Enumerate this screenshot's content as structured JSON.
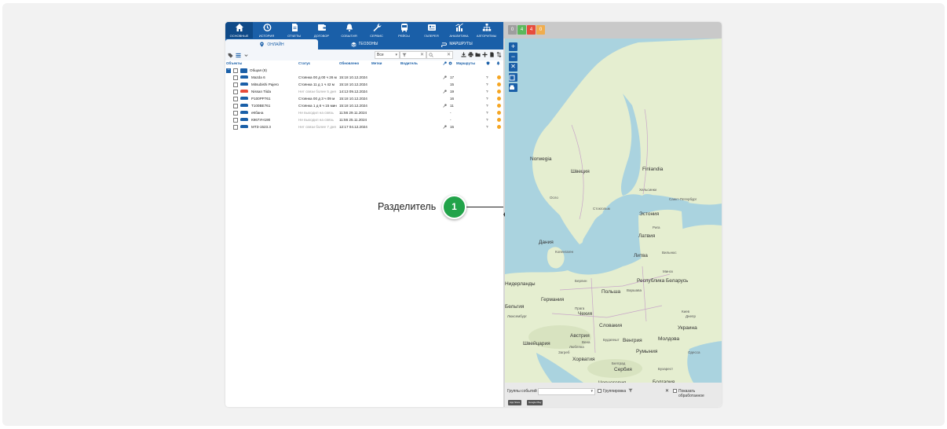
{
  "nav": {
    "items": [
      {
        "label": "Основные",
        "icon": "home-icon",
        "active": true
      },
      {
        "label": "История",
        "icon": "history-icon"
      },
      {
        "label": "Отчеты",
        "icon": "report-icon"
      },
      {
        "label": "Договор",
        "icon": "wallet-icon"
      },
      {
        "label": "События",
        "icon": "bell-icon"
      },
      {
        "label": "Сервис",
        "icon": "wrench-icon"
      },
      {
        "label": "Рейсы",
        "icon": "bus-icon"
      },
      {
        "label": "Галерея",
        "icon": "gallery-icon"
      },
      {
        "label": "Аналитика",
        "icon": "analytics-icon"
      },
      {
        "label": "Алгоритмы",
        "icon": "algorithm-icon"
      }
    ]
  },
  "badges": [
    {
      "value": "0",
      "color": "#9e9e9e"
    },
    {
      "value": "4",
      "color": "#5cb85c"
    },
    {
      "value": "4",
      "color": "#e74c3c"
    },
    {
      "value": "0",
      "color": "#f0ad4e"
    }
  ],
  "tabs": [
    {
      "label": "Онлайн",
      "icon": "pin-icon",
      "active": true
    },
    {
      "label": "Геозоны",
      "icon": "layers-icon"
    },
    {
      "label": "Маршруты",
      "icon": "route-icon"
    }
  ],
  "toolbar": {
    "select_value": "Все",
    "filter_clear": "✕",
    "search_clear": "✕"
  },
  "columns": {
    "objects": "Объекты",
    "status": "Статус",
    "updated": "Обновлено",
    "tags": "Метки",
    "driver": "Водитель",
    "routes": "Маршруты"
  },
  "group": {
    "name": "Общая (8)"
  },
  "objects": [
    {
      "name": "Mazda 6",
      "status": "Стоянка 00 д 00 ч 26 м",
      "time": "15:18 10.12.2024",
      "key": true,
      "routes": "17",
      "q": "?",
      "car_color": "#1a5fa8"
    },
    {
      "name": "Mitsubishi Pajero",
      "status": "Стоянка 11 д 1 ч 42 м",
      "time": "15:18 10.12.2024",
      "key": false,
      "routes": "15",
      "q": "?",
      "car_color": "#1a5fa8"
    },
    {
      "name": "Nissan Tiida",
      "status": "Нет связи более 5 дня",
      "time": "14:13 09.12.2024",
      "key": true,
      "routes": "19",
      "q": "?",
      "car_color": "#e74c3c",
      "status_gray": true
    },
    {
      "name": "Р100РР761",
      "status": "Стоянка 00 д 3 ч 09 м",
      "time": "15:18 10.12.2024",
      "key": false,
      "routes": "16",
      "q": "?",
      "car_color": "#1a5fa8"
    },
    {
      "name": "Т100ВЕ761",
      "status": "Стоянка 1 д 6 ч 15 мин",
      "time": "15:18 10.12.2024",
      "key": true,
      "routes": "11",
      "q": "?",
      "car_color": "#1a5fa8"
    },
    {
      "name": "еКбана",
      "status": "Не выходил на связь",
      "time": "11:56 29.11.2024",
      "key": false,
      "routes": "-",
      "q": "?",
      "car_color": "#1a5fa8",
      "status_gray": true
    },
    {
      "name": "К967УН190",
      "status": "Не выходил на связь",
      "time": "11:56 25.11.2024",
      "key": false,
      "routes": "-",
      "q": "?",
      "car_color": "#1a5fa8",
      "status_gray": true
    },
    {
      "name": "МТЗ-1523.3",
      "status": "Нет связи более 7 дня",
      "time": "12:17 04.12.2024",
      "key": true,
      "routes": "15",
      "q": "?",
      "car_color": "#1a5fa8",
      "status_gray": true
    }
  ],
  "map": {
    "labels": [
      {
        "text": "Norwegia",
        "small": false
      },
      {
        "text": "Швеция",
        "small": false
      },
      {
        "text": "Finlandia",
        "small": false
      },
      {
        "text": "Хельсинки",
        "small": true
      },
      {
        "text": "Санкт-Петербург",
        "small": true
      },
      {
        "text": "Осло",
        "small": true
      },
      {
        "text": "Стокгольм",
        "small": true
      },
      {
        "text": "Эстония",
        "small": false
      },
      {
        "text": "Рига",
        "small": true
      },
      {
        "text": "Латвия",
        "small": false
      },
      {
        "text": "Дания",
        "small": false
      },
      {
        "text": "Копенгаген",
        "small": true
      },
      {
        "text": "Литва",
        "small": false
      },
      {
        "text": "Вильнюс",
        "small": true
      },
      {
        "text": "Минск",
        "small": true
      },
      {
        "text": "Республика Беларусь",
        "small": false
      },
      {
        "text": "Нидерланды",
        "small": false
      },
      {
        "text": "Берлин",
        "small": true
      },
      {
        "text": "Варшава",
        "small": true
      },
      {
        "text": "Польша",
        "small": false
      },
      {
        "text": "Германия",
        "small": false
      },
      {
        "text": "Бельгия",
        "small": false
      },
      {
        "text": "Люксембург",
        "small": true
      },
      {
        "text": "Прага",
        "small": true
      },
      {
        "text": "Чехия",
        "small": false
      },
      {
        "text": "Киев",
        "small": true
      },
      {
        "text": "Украина",
        "small": false
      },
      {
        "text": "Словакия",
        "small": false
      },
      {
        "text": "Вена",
        "small": true
      },
      {
        "text": "Австрия",
        "small": false
      },
      {
        "text": "Будапешт",
        "small": true
      },
      {
        "text": "Венгрия",
        "small": false
      },
      {
        "text": "Молдова",
        "small": false
      },
      {
        "text": "Швейцария",
        "small": false
      },
      {
        "text": "Любляна",
        "small": true
      },
      {
        "text": "Хорватия",
        "small": false
      },
      {
        "text": "Румыния",
        "small": false
      },
      {
        "text": "Бухарест",
        "small": true
      },
      {
        "text": "Сербия",
        "small": false
      },
      {
        "text": "Болгария",
        "small": false
      },
      {
        "text": "Черногория",
        "small": false
      },
      {
        "text": "Днепр",
        "small": true
      },
      {
        "text": "Одесса",
        "small": true
      },
      {
        "text": "Белград",
        "small": true
      },
      {
        "text": "Загреб",
        "small": true
      }
    ],
    "controls": [
      "+",
      "−",
      "✕",
      "",
      ""
    ]
  },
  "events": {
    "label": "Группы событий",
    "grouping": "Группировка",
    "show_processed": "Показать обработанное",
    "clear": "✕"
  },
  "stores": [
    "App Store",
    "Google Play"
  ],
  "annotation": {
    "text": "Разделитель",
    "number": "1"
  },
  "colors": {
    "brand": "#1a5fa8",
    "annotation": "#22a34a",
    "water": "#aad3df",
    "land": "#e5eed0"
  }
}
